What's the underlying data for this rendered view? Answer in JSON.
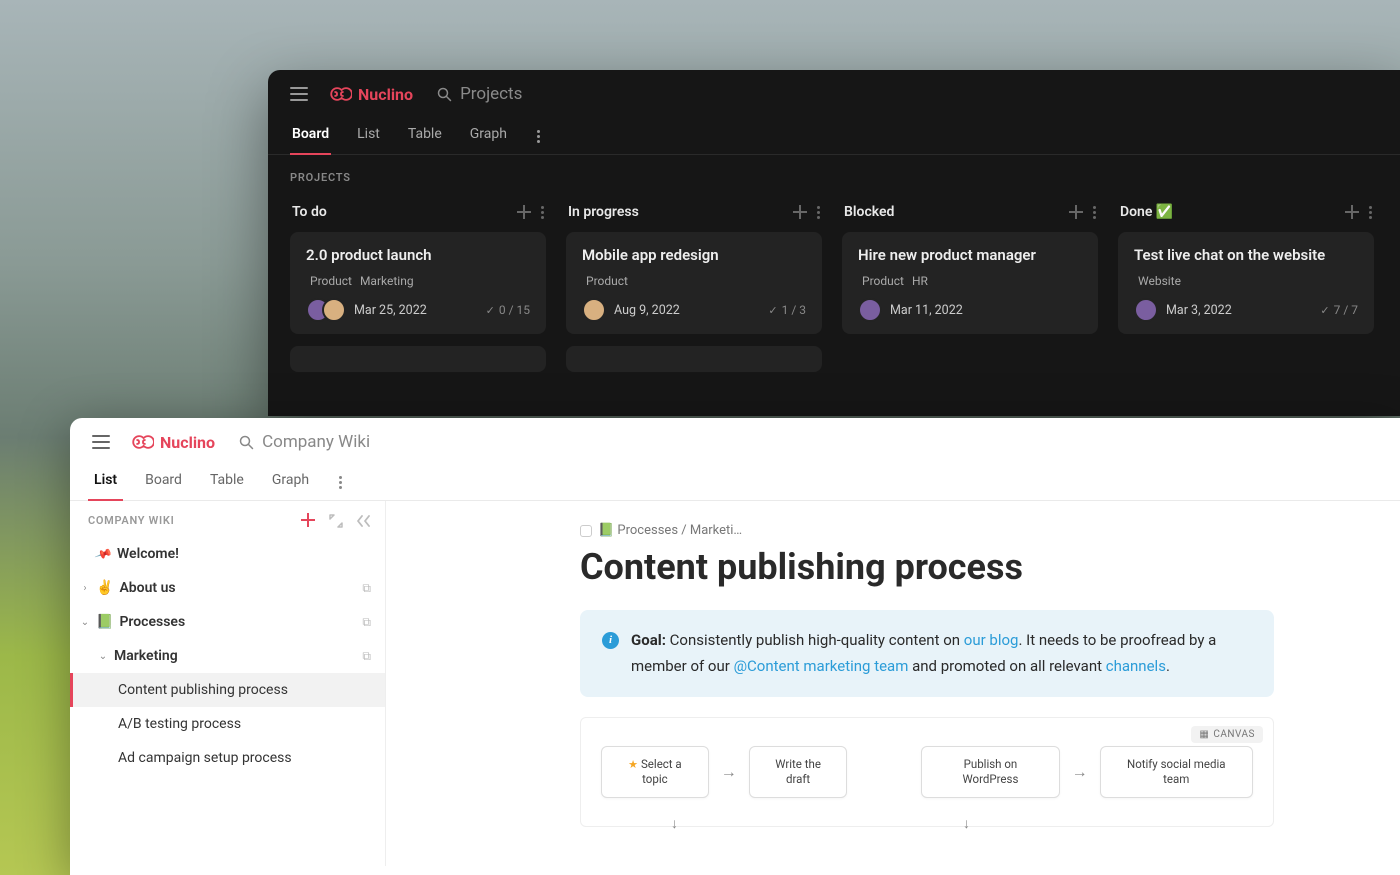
{
  "brand": "Nuclino",
  "dark": {
    "search_placeholder": "Projects",
    "tabs": [
      "Board",
      "List",
      "Table",
      "Graph"
    ],
    "active_tab": "Board",
    "section_label": "PROJECTS",
    "columns": [
      {
        "title": "To do",
        "card": {
          "title": "2.0 product launch",
          "tags": [
            "Product",
            "Marketing"
          ],
          "date": "Mar 25, 2022",
          "progress": "0 / 15",
          "avatar_count": 2
        }
      },
      {
        "title": "In progress",
        "card": {
          "title": "Mobile app redesign",
          "tags": [
            "Product"
          ],
          "date": "Aug 9, 2022",
          "progress": "1 / 3",
          "avatar_count": 1
        }
      },
      {
        "title": "Blocked",
        "card": {
          "title": "Hire new product manager",
          "tags": [
            "Product",
            "HR"
          ],
          "date": "Mar 11, 2022",
          "progress": "",
          "avatar_count": 1
        }
      },
      {
        "title": "Done ✅",
        "card": {
          "title": "Test live chat on the website",
          "tags": [
            "Website"
          ],
          "date": "Mar 3, 2022",
          "progress": "7 / 7",
          "avatar_count": 1
        }
      }
    ]
  },
  "light": {
    "search_placeholder": "Company Wiki",
    "tabs": [
      "List",
      "Board",
      "Table",
      "Graph"
    ],
    "active_tab": "List",
    "side_label": "COMPANY WIKI",
    "tree": {
      "welcome": "Welcome!",
      "about": "About us",
      "processes": "Processes",
      "marketing": "Marketing",
      "items": [
        "Content publishing process",
        "A/B testing process",
        "Ad campaign setup process"
      ]
    },
    "breadcrumb": "📗 Processes / Marketi…",
    "page_title": "Content publishing process",
    "callout": {
      "goal_label": "Goal:",
      "text1": " Consistently publish high-quality content on ",
      "link1": "our blog",
      "text2": ". It needs to be proofread by a member of our ",
      "mention": "@Content marketing team",
      "text3": " and promoted on all relevant ",
      "link2": "channels",
      "text4": "."
    },
    "canvas_badge": "CANVAS",
    "flow": {
      "n1": "Select a topic",
      "n2": "Write the draft",
      "n3": "Publish on WordPress",
      "n4": "Notify social media team"
    }
  }
}
